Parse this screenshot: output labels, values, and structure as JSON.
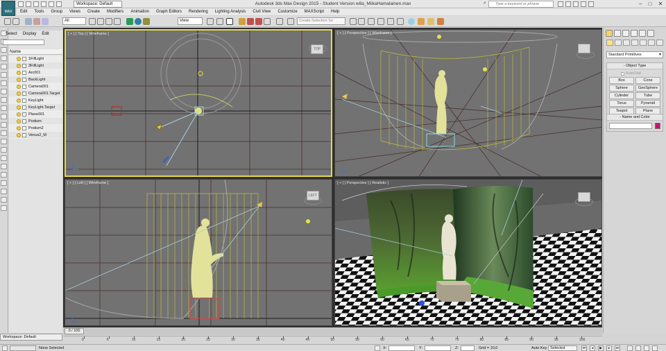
{
  "titlebar": {
    "app_icon_label": "MAX",
    "workspace": "Workspace: Default",
    "title": "Autodesk 3ds Max Design 2015 - Student Version    w8a_MiikaHamalainen.max",
    "search_placeholder": "Type a keyword or phrase"
  },
  "menu": [
    "Edit",
    "Tools",
    "Group",
    "Views",
    "Create",
    "Modifiers",
    "Animation",
    "Graph Editors",
    "Rendering",
    "Lighting Analysis",
    "Civil View",
    "Customize",
    "MAXScript",
    "Help"
  ],
  "toolbar": {
    "selection_filter": "All",
    "reference_coord": "View",
    "named_selection_placeholder": "Create Selection Se"
  },
  "explorer": {
    "tabs": [
      "Select",
      "Display",
      "Edit"
    ],
    "column_header": "Name",
    "items": [
      "1FillLight",
      "3FillLight",
      "Arc001",
      "BackLight",
      "Camera001",
      "Camera001.Target",
      "KeyLight",
      "KeyLight.Target",
      "Plane001",
      "Podium",
      "Podium2",
      "Venus2_M"
    ]
  },
  "viewports": {
    "top": {
      "label": "[ + ] [ Top ] [ Wireframe ]",
      "cube": "TOP"
    },
    "perspective": {
      "label": "[ + ] [ Perspective ] [ Wireframe ]",
      "cube": ""
    },
    "left": {
      "label": "[ + ] [ Left ] [ Wireframe ]",
      "cube": "LEFT"
    },
    "realistic": {
      "label": "[ + ] [ Perspective ] [ Realistic ]",
      "cube": ""
    }
  },
  "command_panel": {
    "category": "Standard Primitives",
    "object_type_title": "Object Type",
    "autogrid": "AutoGrid",
    "buttons": [
      "Box",
      "Cone",
      "Sphere",
      "GeoSphere",
      "Cylinder",
      "Tube",
      "Torus",
      "Pyramid",
      "Teapot",
      "Plane"
    ],
    "name_color_title": "Name and Color",
    "object_color": "#c4147a"
  },
  "bottom": {
    "workspace": "Workspace: Default",
    "time_position": "0 / 100",
    "timeline_ticks": [
      "0",
      "5",
      "10",
      "15",
      "20",
      "25",
      "30",
      "35",
      "40",
      "45",
      "50",
      "55",
      "60",
      "65",
      "70",
      "75",
      "80",
      "85",
      "90",
      "95",
      "100"
    ],
    "status": "None Selected",
    "x_label": "X:",
    "y_label": "Y:",
    "z_label": "Z:",
    "grid": "Grid = 10,0",
    "auto_key": "Auto Key",
    "set_key_mode": "Selected"
  },
  "colors": {
    "viewport_bg": "#727272",
    "active_border": "#e8d94a",
    "wire_yellow": "#d4d45a",
    "wire_grid": "#4a2e2e"
  }
}
